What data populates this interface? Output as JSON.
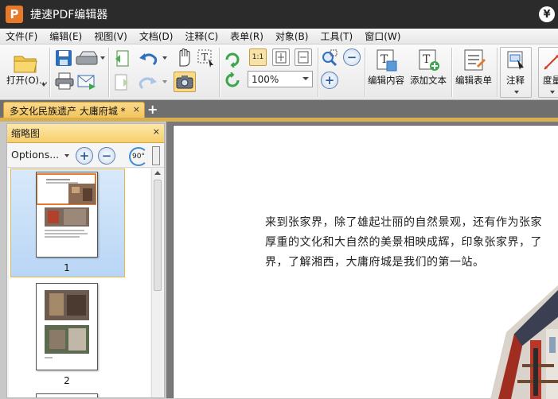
{
  "window": {
    "title": "捷速PDF编辑器",
    "logo_letter": "P",
    "corner_icon": "¥"
  },
  "menu": [
    "文件(F)",
    "编辑(E)",
    "视图(V)",
    "文档(D)",
    "注释(C)",
    "表单(R)",
    "对象(B)",
    "工具(T)",
    "窗口(W)"
  ],
  "toolbar": {
    "open_label": "打开(O)...",
    "zoom_value": "100%",
    "edit_content_label": "编辑内容",
    "add_text_label": "添加文本",
    "edit_form_label": "编辑表单",
    "annotate_label": "注释",
    "measure_label": "度量",
    "actual_size_label": "1:1",
    "rotate_label": "90°"
  },
  "tab": {
    "title": "多文化民族遗产 大庸府城 *",
    "close": "×",
    "new": "+"
  },
  "panel": {
    "title": "缩略图",
    "close": "×",
    "options_label": "Options...",
    "pages": [
      {
        "number": "1"
      },
      {
        "number": "2"
      }
    ]
  },
  "document": {
    "lines": [
      "来到张家界，除了雄起壮丽的自然景观，还有作为张家",
      "厚重的文化和大自然的美景相映成辉，印象张家界，了",
      "界，了解湘西，大庸府城是我们的第一站。"
    ]
  },
  "colors": {
    "accent": "#f2c35a",
    "titlebar": "#2b2b2b",
    "logo": "#e8782a"
  }
}
